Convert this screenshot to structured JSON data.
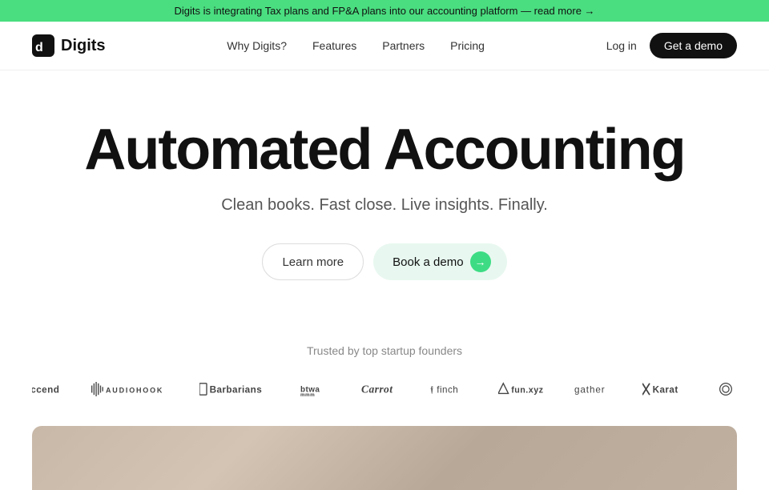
{
  "banner": {
    "text": "Digits is integrating Tax plans and FP&A plans into our accounting platform — read more →"
  },
  "nav": {
    "logo_text": "Digits",
    "links": [
      {
        "label": "Why Digits?",
        "id": "why-digits"
      },
      {
        "label": "Features",
        "id": "features"
      },
      {
        "label": "Partners",
        "id": "partners"
      },
      {
        "label": "Pricing",
        "id": "pricing"
      }
    ],
    "login_label": "Log in",
    "demo_label": "Get a demo"
  },
  "hero": {
    "title": "Automated Accounting",
    "subtitle": "Clean books. Fast close. Live insights. Finally.",
    "learn_more_label": "Learn more",
    "book_demo_label": "Book a demo"
  },
  "trusted": {
    "label": "Trusted by top startup founders",
    "logos": [
      {
        "name": "Accend",
        "display": "Accend"
      },
      {
        "name": "Audiohook",
        "display": "AUDIOHOOK"
      },
      {
        "name": "Barbarians",
        "display": "Barbarians"
      },
      {
        "name": "btwa",
        "display": "btwa"
      },
      {
        "name": "Carrot",
        "display": "Carrot"
      },
      {
        "name": "finch",
        "display": "finch"
      },
      {
        "name": "fun.xyz",
        "display": "fun.xyz"
      },
      {
        "name": "gather",
        "display": "gather"
      },
      {
        "name": "Karat",
        "display": "Karat"
      }
    ],
    "nav_icon": "›"
  },
  "colors": {
    "banner_bg": "#4ade80",
    "demo_btn_bg": "#111111",
    "book_demo_bg": "#e8f8f0",
    "book_demo_icon_bg": "#3ddc84"
  }
}
